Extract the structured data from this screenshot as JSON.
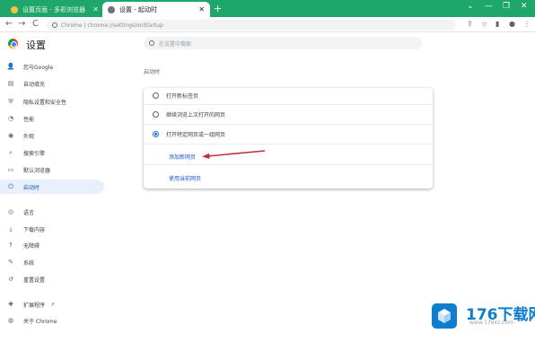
{
  "tabs": [
    {
      "title": "设置页面 - 多彩浏览器",
      "active": false
    },
    {
      "title": "设置 - 起动时",
      "active": true
    }
  ],
  "new_tab_label": "+",
  "window_controls": [
    "⌄",
    "—",
    "❐",
    "✕"
  ],
  "toolbar": {
    "back": "←",
    "forward": "→",
    "reload": "C",
    "url": "Chrome | chrome://settings/onStartup"
  },
  "settings": {
    "title": "设置",
    "search_placeholder": "在设置中搜索"
  },
  "sidebar": {
    "items": [
      {
        "label": "您与Google",
        "icon": "person-icon",
        "glyph": "👤"
      },
      {
        "label": "自动填充",
        "icon": "autofill-icon",
        "glyph": "▤"
      },
      {
        "label": "隐私设置和安全性",
        "icon": "shield-icon",
        "glyph": "⛨"
      },
      {
        "label": "性能",
        "icon": "speed-icon",
        "glyph": "◔"
      },
      {
        "label": "外观",
        "icon": "palette-icon",
        "glyph": "◉"
      },
      {
        "label": "搜索引擎",
        "icon": "search-icon",
        "glyph": "⌕"
      },
      {
        "label": "默认浏览器",
        "icon": "browser-icon",
        "glyph": "▭"
      },
      {
        "label": "启动时",
        "icon": "power-icon",
        "glyph": "⏻"
      },
      {
        "label": "语言",
        "icon": "globe-icon",
        "glyph": "◎"
      },
      {
        "label": "下载内容",
        "icon": "download-icon",
        "glyph": "⤓"
      },
      {
        "label": "无障碍",
        "icon": "accessibility-icon",
        "glyph": "☨"
      },
      {
        "label": "系统",
        "icon": "wrench-icon",
        "glyph": "✎"
      },
      {
        "label": "重置设置",
        "icon": "reset-icon",
        "glyph": "↺"
      },
      {
        "label": "扩展程序",
        "icon": "puzzle-icon",
        "glyph": "✚"
      },
      {
        "label": "关于 Chrome",
        "icon": "chrome-icon",
        "glyph": "◍"
      }
    ],
    "selected_index": 7,
    "external_link_icon": "↗"
  },
  "startup": {
    "section_title": "启动时",
    "options": [
      {
        "label": "打开新标签页",
        "checked": false
      },
      {
        "label": "继续浏览上次打开的网页",
        "checked": false
      },
      {
        "label": "打开特定网页或一组网页",
        "checked": true
      }
    ],
    "add_page_link": "添加新网页",
    "use_current_link": "使用当前网页"
  },
  "watermark": {
    "brand": "176下载网",
    "site": "www.176xz.com"
  },
  "colors": {
    "tab_strip": "#1fa66a",
    "accent": "#1a73e8",
    "selected_bg": "#e8f0fe",
    "annotation_arrow": "#c62d3a",
    "watermark": "#0d7dd0"
  }
}
